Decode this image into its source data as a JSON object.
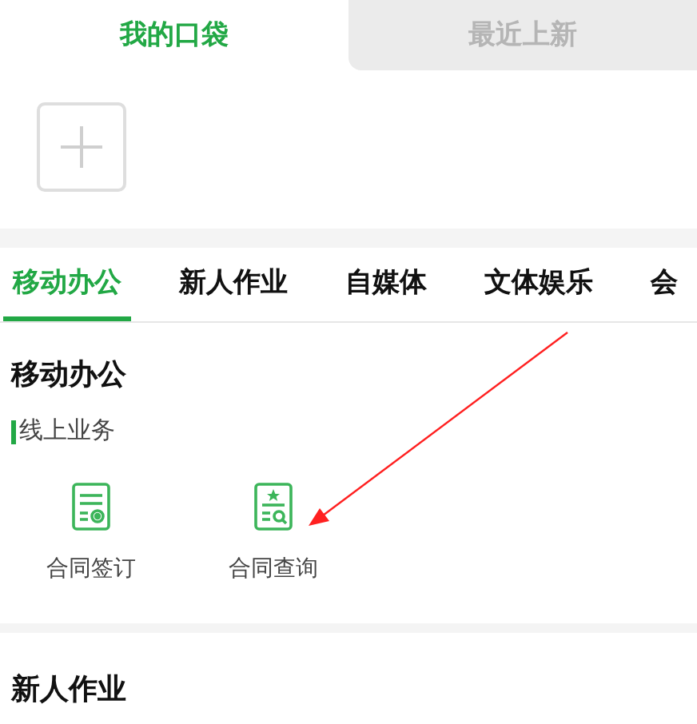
{
  "top_tabs": [
    {
      "label": "我的口袋",
      "selected": true
    },
    {
      "label": "最近上新",
      "selected": false
    }
  ],
  "category_tabs": [
    {
      "label": "移动办公",
      "selected": true
    },
    {
      "label": "新人作业",
      "selected": false
    },
    {
      "label": "自媒体",
      "selected": false
    },
    {
      "label": "文体娱乐",
      "selected": false
    },
    {
      "label": "会",
      "selected": false
    }
  ],
  "sections": [
    {
      "title": "移动办公",
      "subtitle": "线上业务",
      "items": [
        {
          "label": "合同签订",
          "kind": "sign"
        },
        {
          "label": "合同查询",
          "kind": "query"
        }
      ]
    },
    {
      "title": "新人作业"
    }
  ]
}
